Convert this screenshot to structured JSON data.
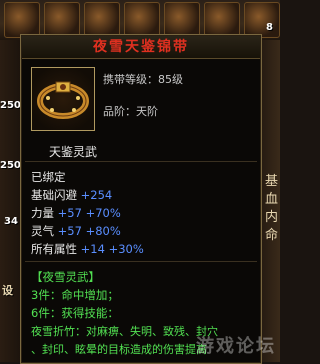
{
  "background": {
    "num_top_right": "8",
    "left_nums": [
      "250",
      "250",
      "34"
    ],
    "left_label": "设",
    "right_chars": [
      "基",
      "血",
      "内",
      "命"
    ]
  },
  "tooltip": {
    "title": "夜雪天鉴锦带",
    "carry_level": "携带等级：85级",
    "grade": "品阶：天阶",
    "subtitle": "天鉴灵武",
    "bound": "已绑定",
    "stats": [
      {
        "name": "基础闪避",
        "value": "+254",
        "pct": ""
      },
      {
        "name": "力量",
        "value": "+57",
        "pct": "+70%"
      },
      {
        "name": "灵气",
        "value": "+57",
        "pct": "+80%"
      },
      {
        "name": "所有属性",
        "value": "+14",
        "pct": "+30%"
      }
    ],
    "set_name": "【夜雪灵武】",
    "set_bonus_3": "3件：命中增加；",
    "set_bonus_6": "6件：获得技能：",
    "skill_line1": "夜雪折竹：对麻痹、失明、致残、封穴",
    "skill_line2": "、封印、眩晕的目标造成的伤害提高",
    "watermark": "游戏论坛"
  },
  "colors": {
    "title": "#e03020",
    "stat_blue": "#5a8eff",
    "set_green": "#52e052",
    "border": "#7a6840"
  },
  "icons": {
    "item": "belt-icon"
  }
}
